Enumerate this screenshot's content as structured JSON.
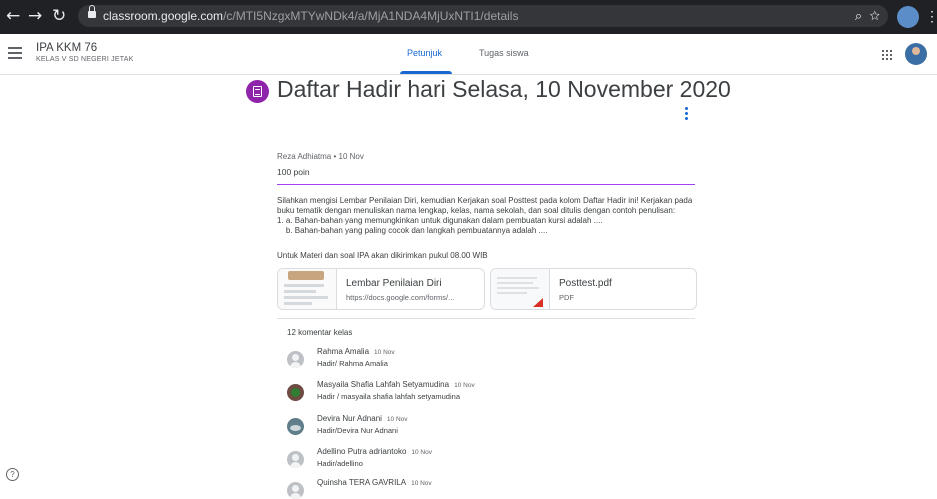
{
  "browser": {
    "url_host": "classroom.google.com",
    "url_path": "/c/MTI5NzgxMTYwNDk4/a/MjA1NDA4MjUxNTI1/details"
  },
  "header": {
    "class_name": "IPA KKM 76",
    "class_section": "KELAS V SD NEGERI JETAK",
    "tabs": [
      {
        "label": "Petunjuk",
        "active": true
      },
      {
        "label": "Tugas siswa",
        "active": false
      }
    ]
  },
  "assignment": {
    "title": "Daftar Hadir hari Selasa, 10 November 2020",
    "meta": "Reza Adhiatma • 10 Nov",
    "points": "100 poin",
    "instructions": [
      "Silahkan mengisi Lembar Penilaian Diri, kemudian Kerjakan soal Posttest pada kolom Daftar Hadir ini! Kerjakan pada",
      "buku tematik dengan menuliskan nama lengkap, kelas, nama sekolah, dan soal ditulis dengan contoh penulisan:",
      "1. a. Bahan-bahan yang memungkinkan untuk digunakan dalam pembuatan kursi adalah ....",
      "    b. Bahan-bahan yang paling cocok dan langkah pembuatannya adalah ...."
    ],
    "note": "Untuk Materi dan soal IPA akan dikirimkan pukul 08.00 WIB",
    "attachments": [
      {
        "title": "Lembar Penilaian Diri",
        "subtitle": "https://docs.google.com/forms/..."
      },
      {
        "title": "Posttest.pdf",
        "subtitle": "PDF"
      }
    ]
  },
  "comments": {
    "count_label": "12 komentar kelas",
    "items": [
      {
        "name": "Rahma Amalia",
        "date": "10 Nov",
        "text": "Hadir/ Rahma Amalia"
      },
      {
        "name": "Masyaila Shafia Lahfah Setyamudina",
        "date": "10 Nov",
        "text": "Hadir / masyaila shafia lahfah setyamudina"
      },
      {
        "name": "Devira Nur Adnani",
        "date": "10 Nov",
        "text": "Hadir/Devira Nur Adnani"
      },
      {
        "name": "Adellino Putra adriantoko",
        "date": "10 Nov",
        "text": "Hadir/adellino"
      },
      {
        "name": "Quinsha TERA GAVRILA",
        "date": "10 Nov",
        "text": ""
      }
    ]
  }
}
